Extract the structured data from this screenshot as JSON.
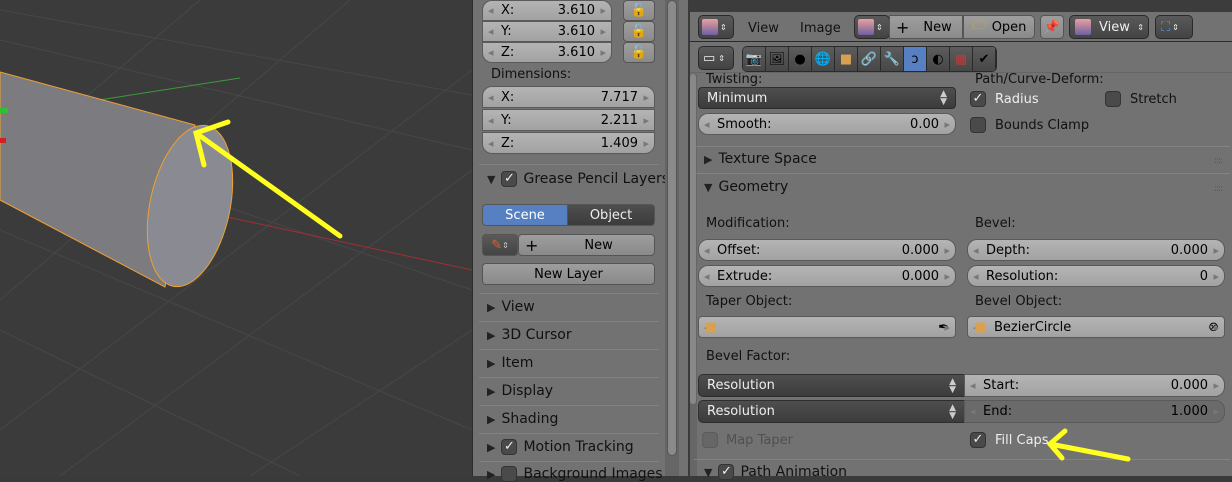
{
  "viewport": {
    "accent_outline": "#f0a030",
    "annotation_color": "#ffff20"
  },
  "n_panel": {
    "scale": [
      {
        "axis": "X:",
        "value": "3.610"
      },
      {
        "axis": "Y:",
        "value": "3.610"
      },
      {
        "axis": "Z:",
        "value": "3.610"
      }
    ],
    "dimensions_label": "Dimensions:",
    "dimensions": [
      {
        "axis": "X:",
        "value": "7.717"
      },
      {
        "axis": "Y:",
        "value": "2.211"
      },
      {
        "axis": "Z:",
        "value": "1.409"
      }
    ],
    "grease_pencil": {
      "title": "Grease Pencil Layers",
      "scene": "Scene",
      "object": "Object",
      "new": "New",
      "new_layer": "New Layer"
    },
    "panels": [
      "View",
      "3D Cursor",
      "Item",
      "Display",
      "Shading",
      "Motion Tracking",
      "Background Images"
    ]
  },
  "image_header": {
    "view": "View",
    "image": "Image",
    "new": "New",
    "open": "Open",
    "view_dropdown": "View"
  },
  "properties": {
    "twisting_label": "Twisting:",
    "twisting_value": "Minimum",
    "smooth_label": "Smooth:",
    "smooth_value": "0.00",
    "deform_label": "Path/Curve-Deform:",
    "radius": "Radius",
    "stretch": "Stretch",
    "bounds_clamp": "Bounds Clamp",
    "texture_space": "Texture Space",
    "geometry": "Geometry",
    "modification": "Modification:",
    "offset_label": "Offset:",
    "offset_value": "0.000",
    "extrude_label": "Extrude:",
    "extrude_value": "0.000",
    "bevel": "Bevel:",
    "depth_label": "Depth:",
    "depth_value": "0.000",
    "resolution_label": "Resolution:",
    "resolution_value": "0",
    "taper_object": "Taper Object:",
    "bevel_object": "Bevel Object:",
    "bevel_object_value": "BezierCircle",
    "bevel_factor": "Bevel Factor:",
    "factor_mode_start": "Resolution",
    "factor_mode_end": "Resolution",
    "start_label": "Start:",
    "start_value": "0.000",
    "end_label": "End:",
    "end_value": "1.000",
    "map_taper": "Map Taper",
    "fill_caps": "Fill Caps",
    "path_animation": "Path Animation"
  }
}
